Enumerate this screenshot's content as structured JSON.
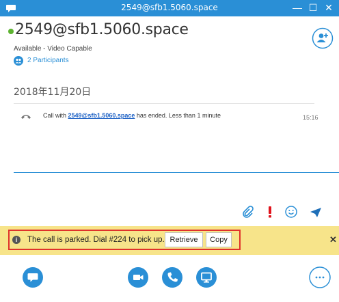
{
  "window": {
    "title": "2549@sfb1.5060.space",
    "controls": {
      "minimize": "—",
      "maximize": "☐",
      "close": "✕"
    }
  },
  "contact": {
    "name": "2549@sfb1.5060.space",
    "status": "Available - Video Capable",
    "participants": "2 Participants",
    "presence_color": "#5db330"
  },
  "conversation": {
    "date": "2018年11月20日",
    "message": {
      "prefix": "Call with ",
      "link": "2549@sfb1.5060.space",
      "suffix": " has ended. Less than 1 minute",
      "time": "15:16",
      "icon": "phone-hangup-icon"
    }
  },
  "compose_toolbar": {
    "icons": [
      "paperclip-icon",
      "exclamation-icon",
      "emoji-icon",
      "send-icon"
    ]
  },
  "notification": {
    "text": "The call is parked. Dial #224 to pick up.",
    "retrieve": "Retrieve",
    "copy": "Copy",
    "close": "✕",
    "highlight_color": "#e0322b",
    "background": "#f7e48a"
  },
  "bottom_bar": {
    "buttons": [
      "im-icon",
      "video-icon",
      "phone-icon",
      "present-icon",
      "more-icon"
    ]
  },
  "colors": {
    "accent": "#2a8fd6"
  }
}
